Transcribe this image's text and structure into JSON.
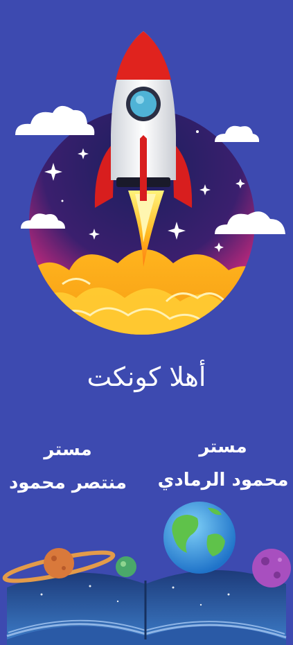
{
  "screen": {
    "title": "أهلا كونكت",
    "teachers": [
      {
        "role": "مستر",
        "name": "منتصر محمود"
      },
      {
        "role": "مستر",
        "name": "محمود الرمادي"
      }
    ]
  },
  "icons": {
    "hero": "rocket-launch-illustration",
    "footer": "open-book-with-planets-illustration"
  },
  "colors": {
    "background": "#3d4ab0",
    "text": "#ffffff",
    "rocket_red": "#d81e1e",
    "flame_yellow": "#ffd21e"
  }
}
